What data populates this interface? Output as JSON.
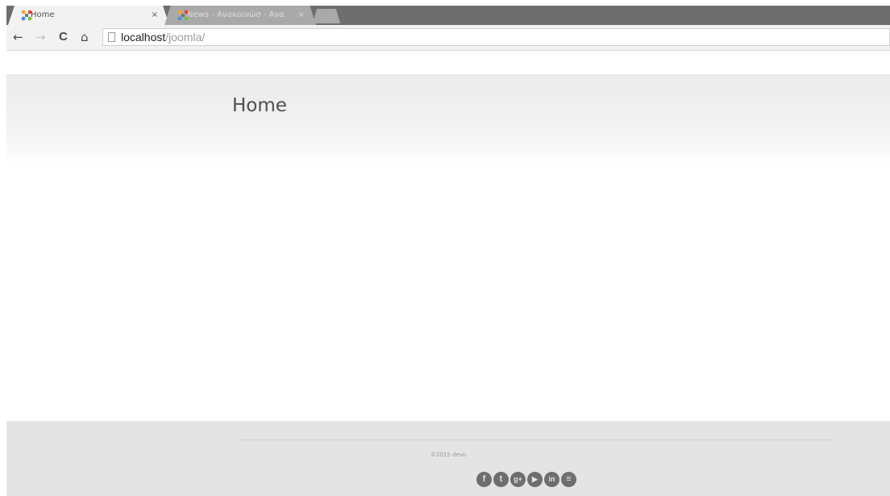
{
  "browser": {
    "tabs": [
      {
        "title": "Home",
        "close": "×"
      },
      {
        "title": "News - Ανακοινώσ - Ανα",
        "close": "×"
      }
    ],
    "nav": {
      "back": "←",
      "forward": "→",
      "reload": "C",
      "home": "⌂"
    },
    "url": {
      "host": "localhost",
      "path": "/joomla/"
    }
  },
  "page": {
    "title": "Home"
  },
  "footer": {
    "copyright": "©2015 devo",
    "social": [
      {
        "icon": "facebook-icon",
        "glyph": "f"
      },
      {
        "icon": "twitter-icon",
        "glyph": "t"
      },
      {
        "icon": "google-plus-icon",
        "glyph": "g+"
      },
      {
        "icon": "youtube-icon",
        "glyph": "▶"
      },
      {
        "icon": "linkedin-icon",
        "glyph": "in"
      },
      {
        "icon": "rss-icon",
        "glyph": "≡"
      }
    ]
  },
  "colors": {
    "tabstrip": "#6e6e6e",
    "active_tab": "#f2f2f2",
    "hero_top": "#ebebeb",
    "footer": "#e4e4e4",
    "social_icon": "#6e6e6e"
  }
}
